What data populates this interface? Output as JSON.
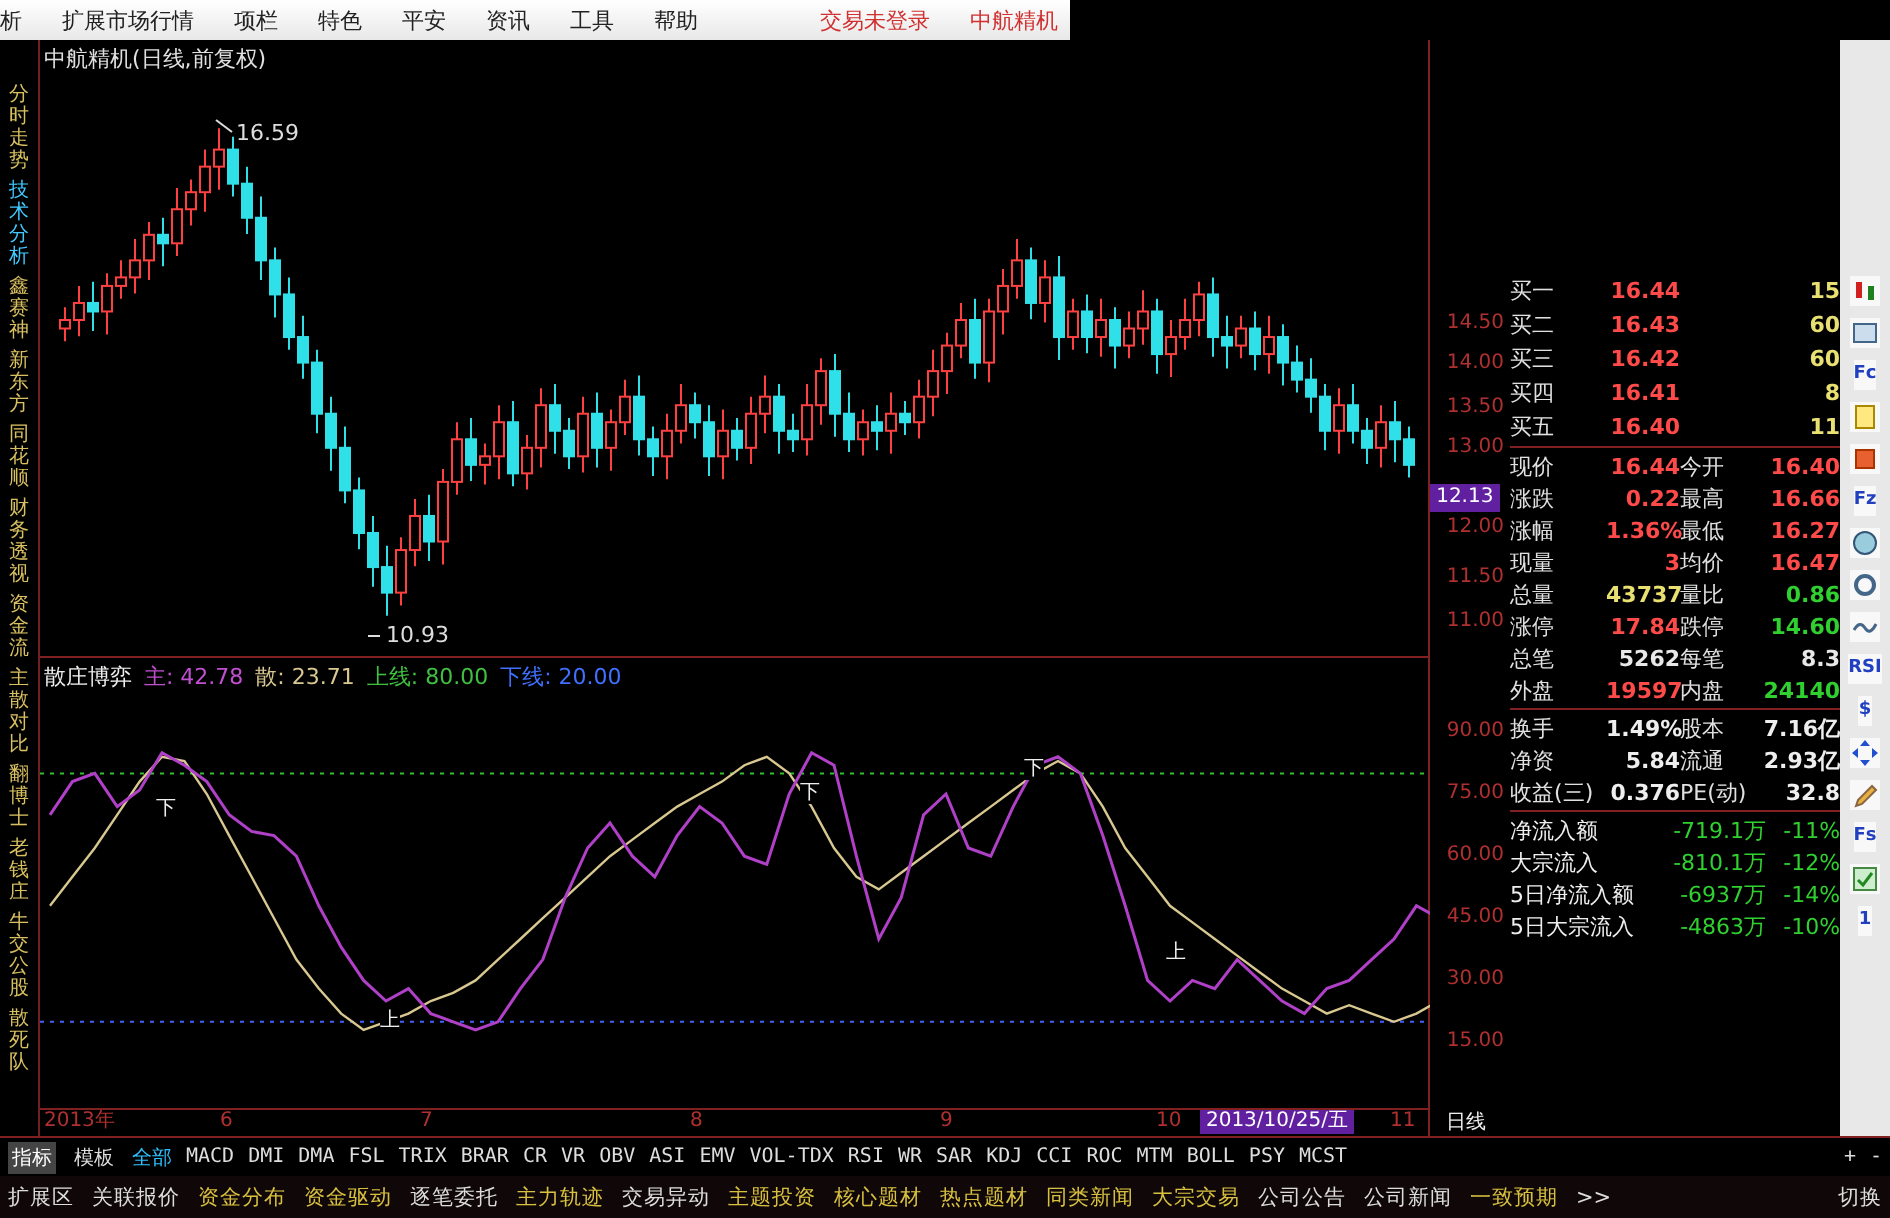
{
  "menu_bar": {
    "items": [
      "析",
      "扩展市场行情",
      "项栏",
      "特色",
      "平安",
      "资讯",
      "工具",
      "帮助"
    ],
    "status_items": [
      "交易未登录",
      "中航精机"
    ]
  },
  "side_tabs": [
    {
      "label": "分时走势",
      "selected": false
    },
    {
      "label": "技术分析",
      "selected": true
    },
    {
      "label": "鑫赛神",
      "selected": false
    },
    {
      "label": "新东方",
      "selected": false
    },
    {
      "label": "同花顺",
      "selected": false
    },
    {
      "label": "财务透视",
      "selected": false
    },
    {
      "label": "资金流",
      "selected": false
    },
    {
      "label": "主散对比",
      "selected": false
    },
    {
      "label": "翻博士",
      "selected": false
    },
    {
      "label": "老钱庄",
      "selected": false
    },
    {
      "label": "牛交公股",
      "selected": false
    },
    {
      "label": "散死队",
      "selected": false
    }
  ],
  "main_chart": {
    "title": "中航精机(日线,前复权)",
    "high_label": "16.59",
    "low_label": "10.93",
    "price_ticks": [
      "14.50",
      "14.00",
      "13.50",
      "13.00",
      "12.00",
      "11.50",
      "11.00"
    ],
    "current_price_tag": "12.13"
  },
  "indicator": {
    "name": "散庄博弈",
    "values": [
      {
        "label": "主:",
        "value": "42.78",
        "color": "#c050d0"
      },
      {
        "label": "散:",
        "value": "23.71",
        "color": "#d8c890"
      },
      {
        "label": "上线:",
        "value": "80.00",
        "color": "#40c040"
      },
      {
        "label": "下线:",
        "value": "20.00",
        "color": "#4070ff"
      }
    ],
    "ticks": [
      "90.00",
      "75.00",
      "60.00",
      "45.00",
      "30.00",
      "15.00"
    ],
    "cross_marks": [
      "下",
      "上",
      "下",
      "下",
      "上"
    ]
  },
  "date_axis": {
    "labels": [
      "2013年",
      "6",
      "7",
      "8",
      "9",
      "10",
      "11"
    ],
    "cursor_date": "2013/10/25/五",
    "period": "日线"
  },
  "quote": {
    "bids": [
      {
        "label": "买一",
        "price": "16.44",
        "volume": "15"
      },
      {
        "label": "买二",
        "price": "16.43",
        "volume": "60"
      },
      {
        "label": "买三",
        "price": "16.42",
        "volume": "60"
      },
      {
        "label": "买四",
        "price": "16.41",
        "volume": "8"
      },
      {
        "label": "买五",
        "price": "16.40",
        "volume": "11"
      }
    ],
    "stats": [
      {
        "left": {
          "label": "现价",
          "value": "16.44",
          "color": "#ff4a4a"
        },
        "right": {
          "label": "今开",
          "value": "16.40",
          "color": "#ff4a4a"
        }
      },
      {
        "left": {
          "label": "涨跌",
          "value": "0.22",
          "color": "#ff4a4a"
        },
        "right": {
          "label": "最高",
          "value": "16.66",
          "color": "#ff4a4a"
        }
      },
      {
        "left": {
          "label": "涨幅",
          "value": "1.36%",
          "color": "#ff4a4a"
        },
        "right": {
          "label": "最低",
          "value": "16.27",
          "color": "#ff4a4a"
        }
      },
      {
        "left": {
          "label": "现量",
          "value": "3",
          "color": "#ff4a4a"
        },
        "right": {
          "label": "均价",
          "value": "16.47",
          "color": "#ff4a4a"
        }
      },
      {
        "left": {
          "label": "总量",
          "value": "43737",
          "color": "#e8e070"
        },
        "right": {
          "label": "量比",
          "value": "0.86",
          "color": "#30d030"
        }
      },
      {
        "left": {
          "label": "涨停",
          "value": "17.84",
          "color": "#ff4a4a"
        },
        "right": {
          "label": "跌停",
          "value": "14.60",
          "color": "#30d030"
        }
      },
      {
        "left": {
          "label": "总笔",
          "value": "5262",
          "color": "#e8e8e8"
        },
        "right": {
          "label": "每笔",
          "value": "8.3",
          "color": "#e8e8e8"
        }
      },
      {
        "left": {
          "label": "外盘",
          "value": "19597",
          "color": "#ff4a4a"
        },
        "right": {
          "label": "内盘",
          "value": "24140",
          "color": "#30d030"
        }
      }
    ],
    "fundamentals": [
      {
        "label1": "换手",
        "value1": "1.49%",
        "label2": "股本",
        "value2": "7.16亿"
      },
      {
        "label1": "净资",
        "value1": "5.84",
        "label2": "流通",
        "value2": "2.93亿"
      },
      {
        "label1": "收益(三)",
        "value1": "0.376",
        "label2": "PE(动)",
        "value2": "32.8"
      }
    ],
    "flows": [
      {
        "label": "净流入额",
        "amount": "-719.1万",
        "percent": "-11%"
      },
      {
        "label": "大宗流入",
        "amount": "-810.1万",
        "percent": "-12%"
      },
      {
        "label": "5日净流入额",
        "amount": "-6937万",
        "percent": "-14%"
      },
      {
        "label": "5日大宗流入",
        "amount": "-4863万",
        "percent": "-10%"
      }
    ]
  },
  "toolbar": [
    {
      "kind": "candle"
    },
    {
      "kind": "window"
    },
    {
      "kind": "text",
      "label": "Fc"
    },
    {
      "kind": "note"
    },
    {
      "kind": "stop"
    },
    {
      "kind": "text",
      "label": "Fz"
    },
    {
      "kind": "globe"
    },
    {
      "kind": "circle"
    },
    {
      "kind": "wave"
    },
    {
      "kind": "text",
      "label": "RSI"
    },
    {
      "kind": "text",
      "label": "$"
    },
    {
      "kind": "move"
    },
    {
      "kind": "pencil"
    },
    {
      "kind": "text",
      "label": "Fs"
    },
    {
      "kind": "check"
    },
    {
      "kind": "text",
      "label": "1"
    }
  ],
  "mode_tabs": [
    {
      "label": "指标",
      "selected": true
    },
    {
      "label": "模板",
      "selected": false
    }
  ],
  "indicator_tabs": [
    {
      "label": "全部",
      "selected": true
    },
    {
      "label": "MACD",
      "selected": false
    },
    {
      "label": "DMI",
      "selected": false
    },
    {
      "label": "DMA",
      "selected": false
    },
    {
      "label": "FSL",
      "selected": false
    },
    {
      "label": "TRIX",
      "selected": false
    },
    {
      "label": "BRAR",
      "selected": false
    },
    {
      "label": "CR",
      "selected": false
    },
    {
      "label": "VR",
      "selected": false
    },
    {
      "label": "OBV",
      "selected": false
    },
    {
      "label": "ASI",
      "selected": false
    },
    {
      "label": "EMV",
      "selected": false
    },
    {
      "label": "VOL-TDX",
      "selected": false
    },
    {
      "label": "RSI",
      "selected": false
    },
    {
      "label": "WR",
      "selected": false
    },
    {
      "label": "SAR",
      "selected": false
    },
    {
      "label": "KDJ",
      "selected": false
    },
    {
      "label": "CCI",
      "selected": false
    },
    {
      "label": "ROC",
      "selected": false
    },
    {
      "label": "MTM",
      "selected": false
    },
    {
      "label": "BOLL",
      "selected": false
    },
    {
      "label": "PSY",
      "selected": false
    },
    {
      "label": "MCST",
      "selected": false
    }
  ],
  "zoom_buttons": [
    "+",
    "-"
  ],
  "bottom_tabs": [
    {
      "label": "扩展区",
      "highlighted": false
    },
    {
      "label": "关联报价",
      "highlighted": false
    },
    {
      "label": "资金分布",
      "highlighted": true
    },
    {
      "label": "资金驱动",
      "highlighted": true
    },
    {
      "label": "逐笔委托",
      "highlighted": false
    },
    {
      "label": "主力轨迹",
      "highlighted": true
    },
    {
      "label": "交易异动",
      "highlighted": false
    },
    {
      "label": "主题投资",
      "highlighted": true
    },
    {
      "label": "核心题材",
      "highlighted": true
    },
    {
      "label": "热点题材",
      "highlighted": true
    },
    {
      "label": "同类新闻",
      "highlighted": true
    },
    {
      "label": "大宗交易",
      "highlighted": true
    },
    {
      "label": "公司公告",
      "highlighted": false
    },
    {
      "label": "公司新闻",
      "highlighted": false
    },
    {
      "label": "一致预期",
      "highlighted": true
    },
    {
      "label": ">>",
      "highlighted": false
    }
  ],
  "switch_button": "切换"
}
